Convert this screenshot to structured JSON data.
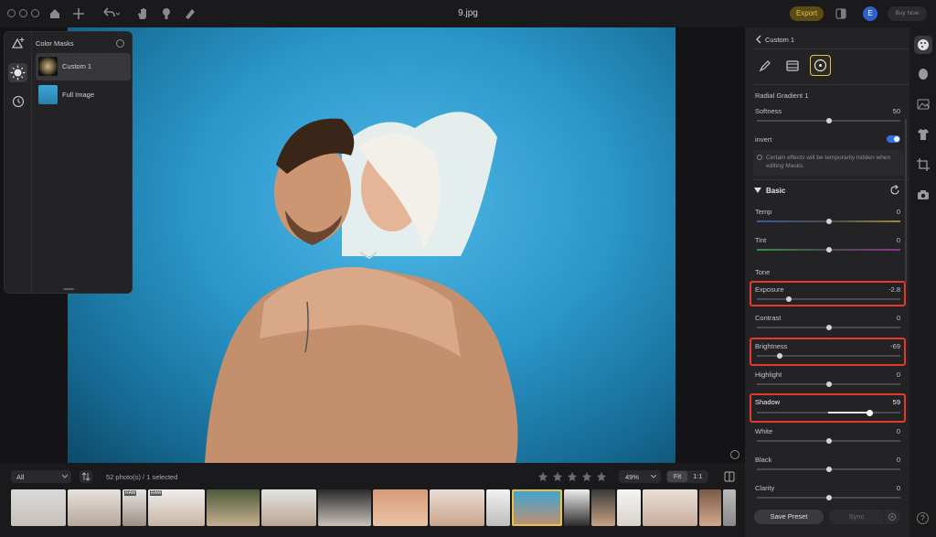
{
  "topbar": {
    "title": "9.jpg",
    "export_label": "Export",
    "avatar_letter": "E",
    "buy_label": "Buy Now"
  },
  "masks": {
    "title": "Color Masks",
    "items": [
      {
        "label": "Custom 1"
      },
      {
        "label": "Full Image"
      }
    ]
  },
  "filmstrip": {
    "filter_value": "All",
    "count_text": "52 photo(s) / 1 selected",
    "zoom_value": "49%",
    "fit_label": "Fit",
    "one_to_one_label": "1:1",
    "raw_badge": "RAW"
  },
  "panel": {
    "back_label": "Custom 1",
    "mask_type": "Radial Gradient 1",
    "softness": {
      "label": "Softness",
      "value": "50",
      "level": 0.5
    },
    "invert": {
      "label": "invert",
      "on": true
    },
    "info_text": "Certain effects will be temporarily hidden when editing Masks.",
    "section_title": "Basic",
    "tone_label": "Tone",
    "sliders": [
      {
        "label": "Temp",
        "value": "0",
        "level": 0.5
      },
      {
        "label": "Tint",
        "value": "0",
        "level": 0.5
      },
      {
        "label": "Exposure",
        "value": "-2.8",
        "level": 0.22
      },
      {
        "label": "Contrast",
        "value": "0",
        "level": 0.5
      },
      {
        "label": "Brightness",
        "value": "-69",
        "level": 0.16
      },
      {
        "label": "Highlight",
        "value": "0",
        "level": 0.5
      },
      {
        "label": "Shadow",
        "value": "59",
        "level": 0.8
      },
      {
        "label": "White",
        "value": "0",
        "level": 0.5
      },
      {
        "label": "Black",
        "value": "0",
        "level": 0.5
      },
      {
        "label": "Clarity",
        "value": "0",
        "level": 0.5
      }
    ],
    "save_preset_label": "Save Preset",
    "sync_label": "Sync"
  },
  "colors": {
    "accent": "#e6c24c",
    "highlight": "#e23b2a",
    "toggle": "#2f6fe0"
  }
}
